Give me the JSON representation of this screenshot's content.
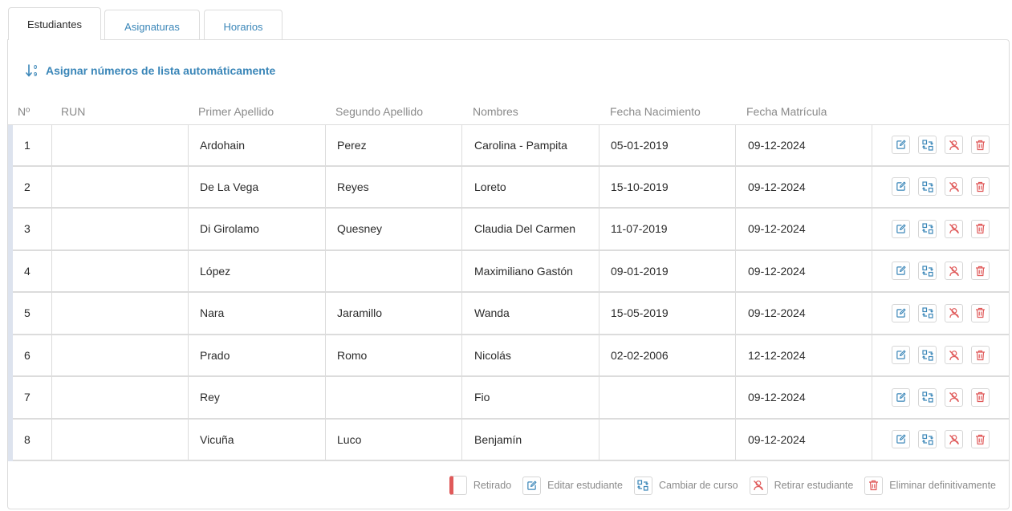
{
  "tabs": [
    {
      "label": "Estudiantes",
      "active": true
    },
    {
      "label": "Asignaturas",
      "active": false
    },
    {
      "label": "Horarios",
      "active": false
    }
  ],
  "assign_link": "Asignar números de lista automáticamente",
  "columns": [
    "Nº",
    "RUN",
    "Primer Apellido",
    "Segundo Apellido",
    "Nombres",
    "Fecha Nacimiento",
    "Fecha Matrícula"
  ],
  "rows": [
    {
      "n": "1",
      "ap1": "Ardohain",
      "ap2": "Perez",
      "nombres": "Carolina - Pampita",
      "nac": "05-01-2019",
      "mat": "09-12-2024"
    },
    {
      "n": "2",
      "ap1": "De La Vega",
      "ap2": "Reyes",
      "nombres": "Loreto",
      "nac": "15-10-2019",
      "mat": "09-12-2024"
    },
    {
      "n": "3",
      "ap1": "Di Girolamo",
      "ap2": "Quesney",
      "nombres": "Claudia Del Carmen",
      "nac": "11-07-2019",
      "mat": "09-12-2024"
    },
    {
      "n": "4",
      "ap1": "López",
      "ap2": "",
      "nombres": "Maximiliano Gastón",
      "nac": "09-01-2019",
      "mat": "09-12-2024"
    },
    {
      "n": "5",
      "ap1": "Nara",
      "ap2": "Jaramillo",
      "nombres": "Wanda",
      "nac": "15-05-2019",
      "mat": "09-12-2024"
    },
    {
      "n": "6",
      "ap1": "Prado",
      "ap2": "Romo",
      "nombres": "Nicolás",
      "nac": "02-02-2006",
      "mat": "12-12-2024"
    },
    {
      "n": "7",
      "ap1": "Rey",
      "ap2": "",
      "nombres": "Fio",
      "nac": "",
      "mat": "09-12-2024"
    },
    {
      "n": "8",
      "ap1": "Vicuña",
      "ap2": "Luco",
      "nombres": "Benjamín",
      "nac": "",
      "mat": "09-12-2024"
    }
  ],
  "legend": {
    "retirado": "Retirado",
    "editar": "Editar estudiante",
    "cambiar": "Cambiar de curso",
    "retirar": "Retirar estudiante",
    "eliminar": "Eliminar definitivamente"
  },
  "colors": {
    "accent": "#3a86b8",
    "danger": "#e05a5a",
    "border": "#dcdcdc",
    "muted": "#8a8a8a"
  },
  "icons": {
    "edit": "edit-icon",
    "switch": "switch-course-icon",
    "withdraw": "withdraw-user-icon",
    "delete": "trash-icon",
    "sort": "sort-numeric-icon"
  }
}
